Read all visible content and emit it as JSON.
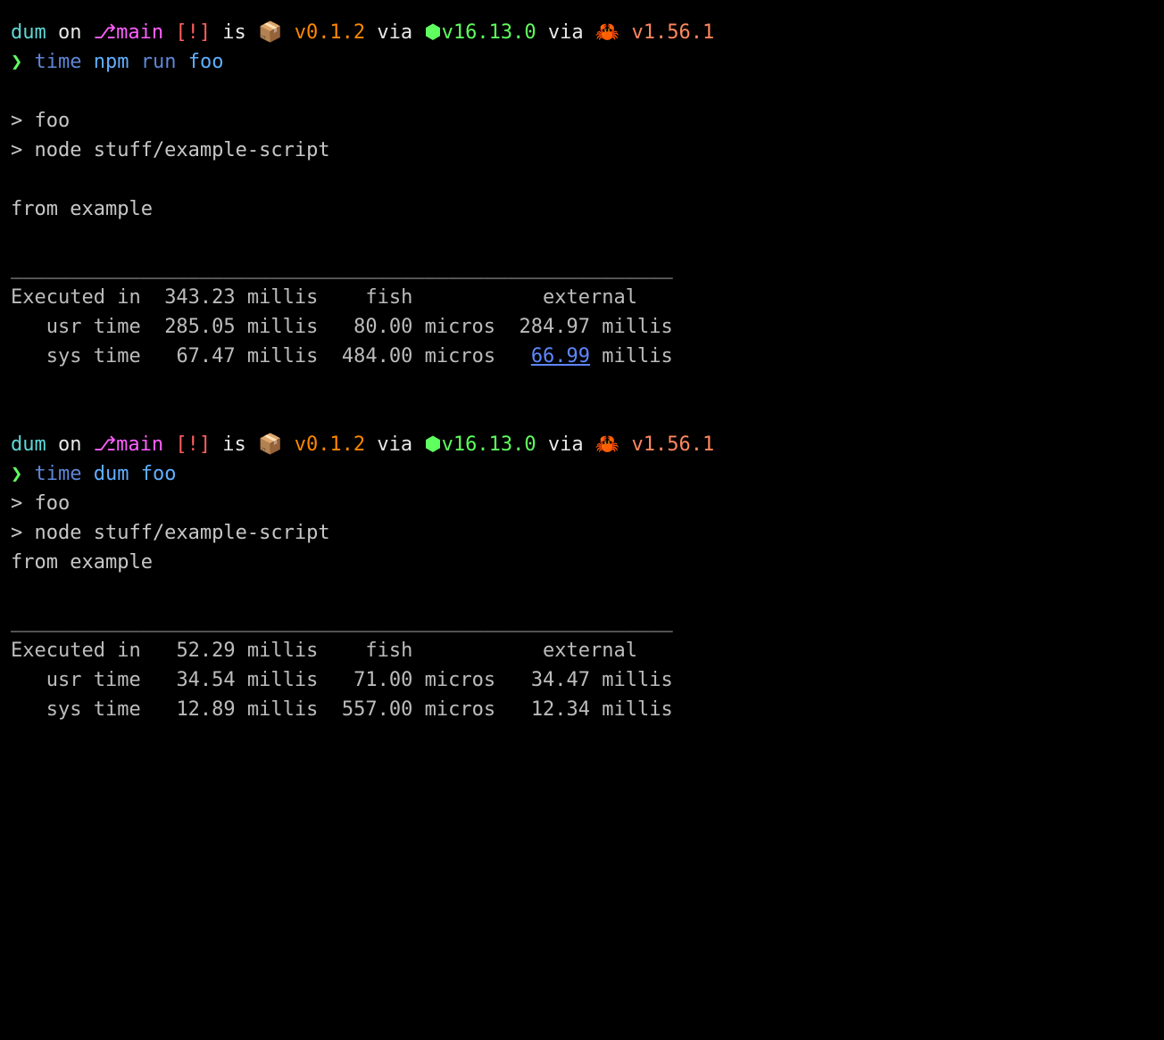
{
  "prompt1": {
    "project": "dum",
    "on": " on ",
    "branch_icon": "⎇",
    "branch": "main",
    "status": " [!]",
    "is": " is ",
    "pkg_icon": "📦",
    "pkg_version": " v0.1.2",
    "via1": " via ",
    "node_icon": "⬢",
    "node_version": "v16.13.0",
    "via2": " via ",
    "rust_icon": "🦀",
    "rust_version": " v1.56.1",
    "arrow": "❯",
    "cmd_time": " time",
    "cmd_npm": " npm",
    "cmd_run": " run",
    "cmd_foo": " foo"
  },
  "output1": {
    "l1": "> foo",
    "l2": "> node stuff/example-script",
    "l3": "from example",
    "divider": "________________________________________________________",
    "exec_label": "Executed in  ",
    "exec_val": "343.23 millis",
    "exec_fish": "    fish           external",
    "usr_label": "   usr time  ",
    "usr_val": "285.05 millis",
    "usr_fish": "   80.00 micros  ",
    "usr_ext": "284.97 millis",
    "sys_label": "   sys time   ",
    "sys_val": "67.47 millis",
    "sys_fish": "  484.00 micros   ",
    "sys_ext_val": "66.99",
    "sys_ext_unit": " millis"
  },
  "prompt2": {
    "project": "dum",
    "on": " on ",
    "branch_icon": "⎇",
    "branch": "main",
    "status": " [!]",
    "is": " is ",
    "pkg_icon": "📦",
    "pkg_version": " v0.1.2",
    "via1": " via ",
    "node_icon": "⬢",
    "node_version": "v16.13.0",
    "via2": " via ",
    "rust_icon": "🦀",
    "rust_version": " v1.56.1",
    "arrow": "❯",
    "cmd_time": " time",
    "cmd_dum": " dum",
    "cmd_foo": " foo"
  },
  "output2": {
    "l1": "> foo",
    "l2": "> node stuff/example-script",
    "l3": "from example",
    "divider": "________________________________________________________",
    "exec_label": "Executed in   ",
    "exec_val": "52.29 millis",
    "exec_fish": "    fish           external",
    "usr_label": "   usr time   ",
    "usr_val": "34.54 millis",
    "usr_fish": "   71.00 micros   ",
    "usr_ext": "34.47 millis",
    "sys_label": "   sys time   ",
    "sys_val": "12.89 millis",
    "sys_fish": "  557.00 micros   ",
    "sys_ext": "12.34 millis"
  }
}
